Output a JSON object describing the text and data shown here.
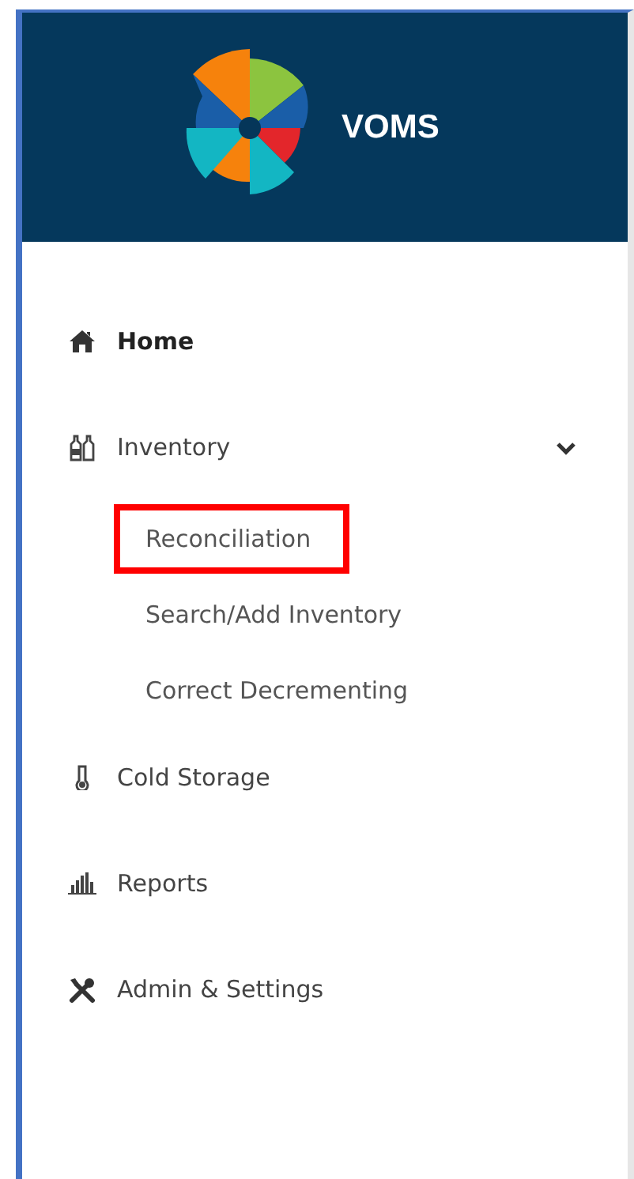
{
  "header": {
    "brand": "VOMS"
  },
  "menu": [
    {
      "label": "Home",
      "selected": true
    },
    {
      "label": "Inventory",
      "selected": false,
      "expanded": true,
      "children": [
        {
          "label": "Reconciliation",
          "highlighted": true
        },
        {
          "label": "Search/Add Inventory",
          "highlighted": false
        },
        {
          "label": "Correct Decrementing",
          "highlighted": false
        }
      ]
    },
    {
      "label": "Cold Storage",
      "selected": false
    },
    {
      "label": "Reports",
      "selected": false
    },
    {
      "label": "Admin & Settings",
      "selected": false
    }
  ]
}
